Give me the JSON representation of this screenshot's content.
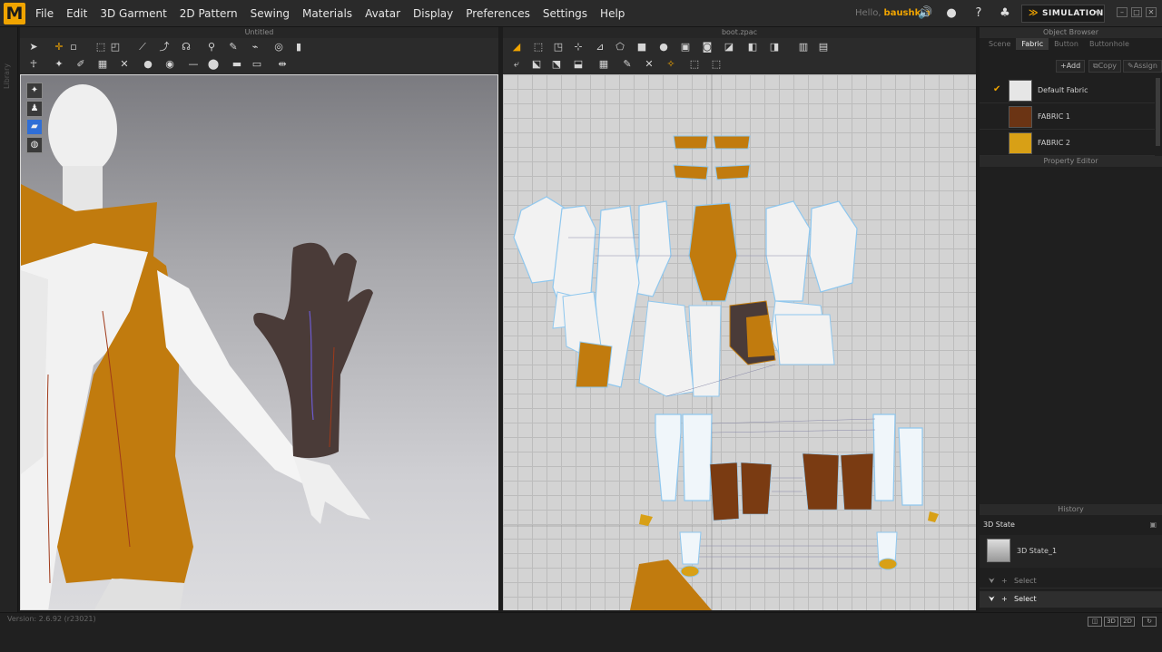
{
  "menubar": {
    "logo": "M",
    "items": [
      "File",
      "Edit",
      "3D Garment",
      "2D Pattern",
      "Sewing",
      "Materials",
      "Avatar",
      "Display",
      "Preferences",
      "Settings",
      "Help"
    ],
    "hello_label": "Hello,",
    "username": "baushkin",
    "simulation_label": "SIMULATION"
  },
  "left_strip_label": "Library",
  "viewport3d": {
    "title": "Untitled"
  },
  "viewport2d": {
    "title": "boot.zpac"
  },
  "object_browser": {
    "title": "Object Browser",
    "tabs": [
      {
        "label": "Scene",
        "active": false
      },
      {
        "label": "Fabric",
        "active": true
      },
      {
        "label": "Button",
        "active": false
      },
      {
        "label": "Buttonhole",
        "active": false
      }
    ],
    "add_label": "Add",
    "copy_label": "Copy",
    "assign_label": "Assign",
    "fabrics": [
      {
        "name": "Default Fabric",
        "color": "#e6e6e6",
        "selected": true
      },
      {
        "name": "FABRIC 1",
        "color": "#6b3414",
        "selected": false
      },
      {
        "name": "FABRIC 2",
        "color": "#d8a016",
        "selected": false
      }
    ]
  },
  "property_editor": {
    "title": "Property Editor"
  },
  "history": {
    "title": "History",
    "state_heading": "3D State",
    "state_item": "3D State_1",
    "actions": [
      "Select",
      "Select"
    ]
  },
  "status": {
    "version": "Version: 2.6.92     (r23021)",
    "view_buttons": [
      "3D",
      "2D"
    ]
  },
  "colors": {
    "accent": "#f0a400",
    "garment_orange": "#c17b0e",
    "glove_brown": "#4a3b38",
    "pattern_brown": "#7a3b12"
  }
}
